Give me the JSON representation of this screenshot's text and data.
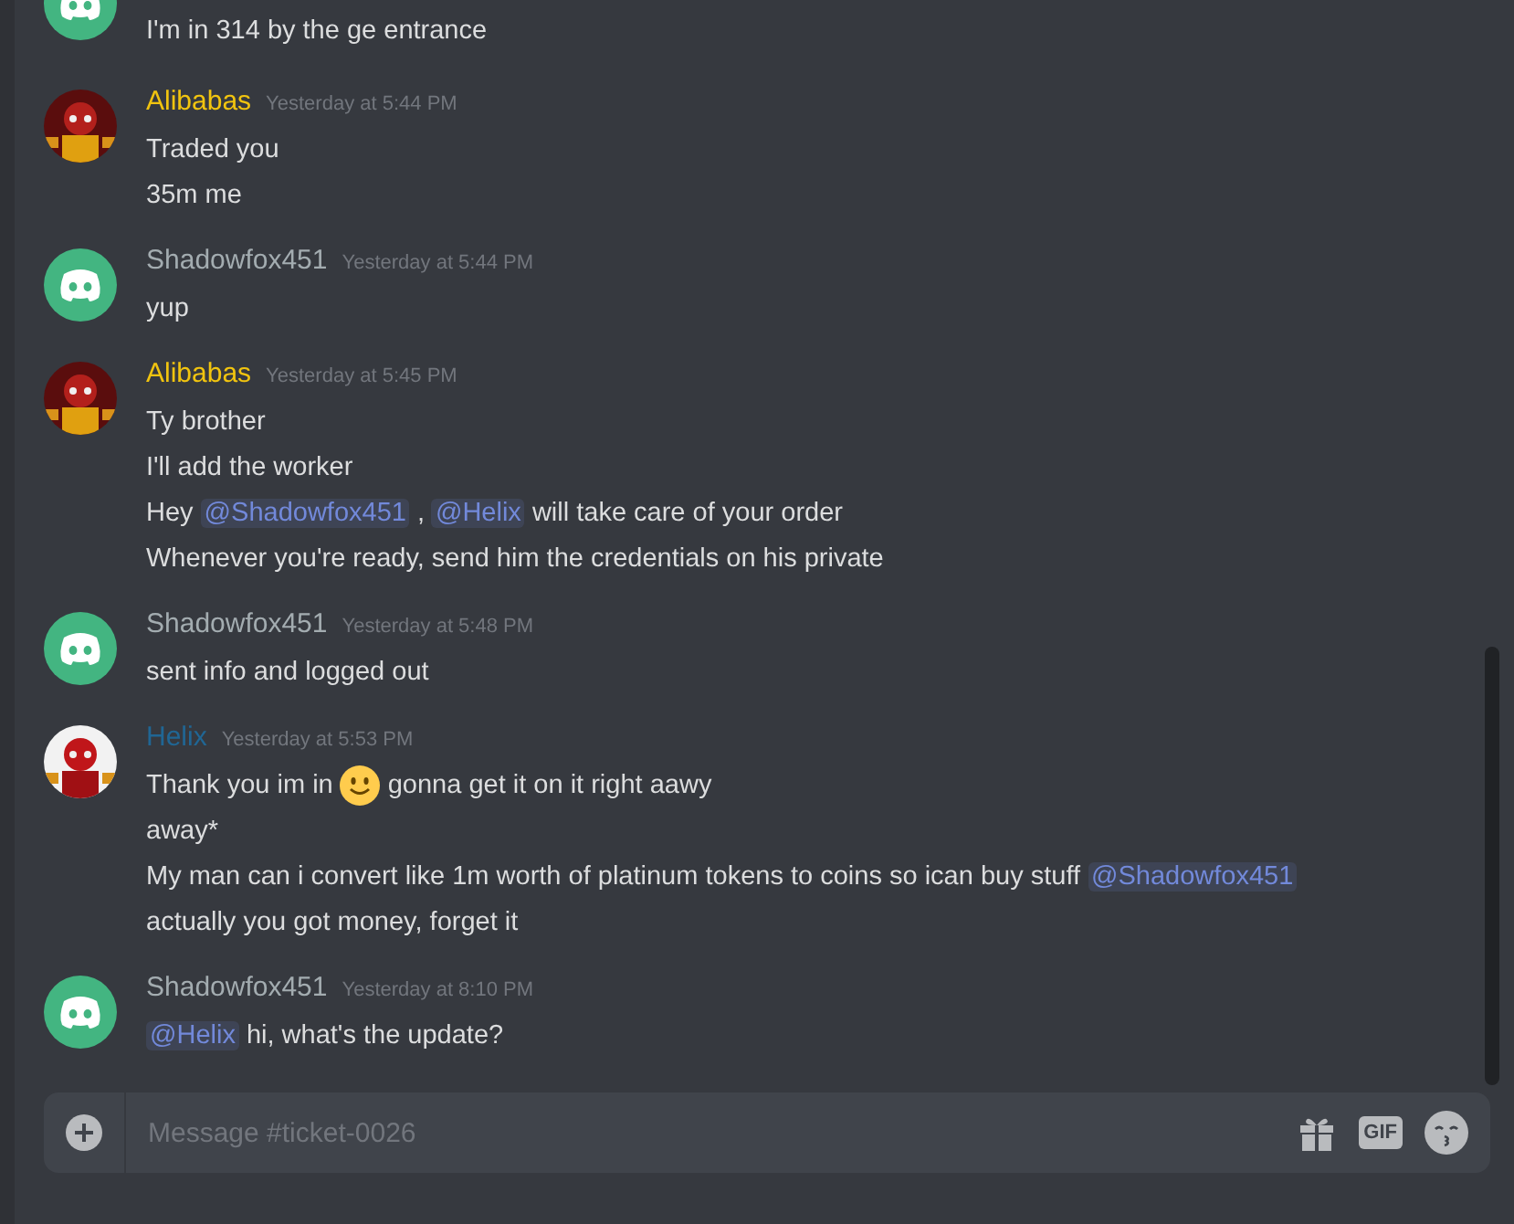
{
  "messages": [
    {
      "kind": "default",
      "lines": [
        [
          {
            "kind": "text",
            "text": "I'm in 314 by the ge entrance"
          }
        ]
      ]
    },
    {
      "author": {
        "name": "Alibabas",
        "color": "#f1c40f",
        "time": "Yesterday at 5:44 PM"
      },
      "kind": "picture",
      "lines": [
        [
          {
            "kind": "text",
            "text": "Traded you"
          }
        ],
        [
          {
            "kind": "text",
            "text": "35m me"
          }
        ]
      ]
    },
    {
      "author": {
        "name": "Shadowfox451",
        "color": "#a3acb0",
        "time": "Yesterday at 5:44 PM"
      },
      "kind": "default",
      "lines": [
        [
          {
            "kind": "text",
            "text": "yup"
          }
        ]
      ]
    },
    {
      "author": {
        "name": "Alibabas",
        "color": "#f1c40f",
        "time": "Yesterday at 5:45 PM"
      },
      "kind": "picture",
      "lines": [
        [
          {
            "kind": "text",
            "text": "Ty brother"
          }
        ],
        [
          {
            "kind": "text",
            "text": "I'll add the worker"
          }
        ],
        [
          {
            "kind": "text",
            "text": "Hey"
          },
          {
            "kind": "mention",
            "text": "@Shadowfox451"
          },
          {
            "kind": "text",
            "text": ","
          },
          {
            "kind": "mention",
            "text": "@Helix"
          },
          {
            "kind": "text",
            "text": "will take care of your order"
          }
        ],
        [
          {
            "kind": "text",
            "text": "Whenever you're ready, send him the credentials on his private"
          }
        ]
      ]
    },
    {
      "author": {
        "name": "Shadowfox451",
        "color": "#a3acb0",
        "time": "Yesterday at 5:48 PM"
      },
      "kind": "default",
      "lines": [
        [
          {
            "kind": "text",
            "text": "sent info and logged out"
          }
        ]
      ]
    },
    {
      "author": {
        "name": "Helix",
        "color": "#206694",
        "time": "Yesterday at 5:53 PM"
      },
      "kind": "picture",
      "lines": [
        [
          {
            "kind": "text",
            "text": "Thank you im in"
          },
          {
            "kind": "emoji"
          },
          {
            "kind": "text",
            "text": "gonna get it on it right aawy"
          }
        ],
        [
          {
            "kind": "text",
            "text": "away*"
          }
        ],
        [
          {
            "kind": "text",
            "text": "My man can i convert like 1m worth of platinum tokens to coins so ican buy stuff"
          },
          {
            "kind": "mention",
            "text": "@Shadowfox451"
          }
        ],
        [
          {
            "kind": "text",
            "text": "actually you got money, forget it"
          }
        ]
      ]
    },
    {
      "author": {
        "name": "Shadowfox451",
        "color": "#a3acb0",
        "time": "Yesterday at 8:10 PM"
      },
      "kind": "default",
      "lines": [
        [
          {
            "kind": "mention",
            "text": "@Helix"
          },
          {
            "kind": "text",
            "text": "hi, what's the update?"
          }
        ]
      ]
    }
  ],
  "composer": {
    "placeholder": "Message #ticket-0026",
    "gif_label": "GIF"
  }
}
